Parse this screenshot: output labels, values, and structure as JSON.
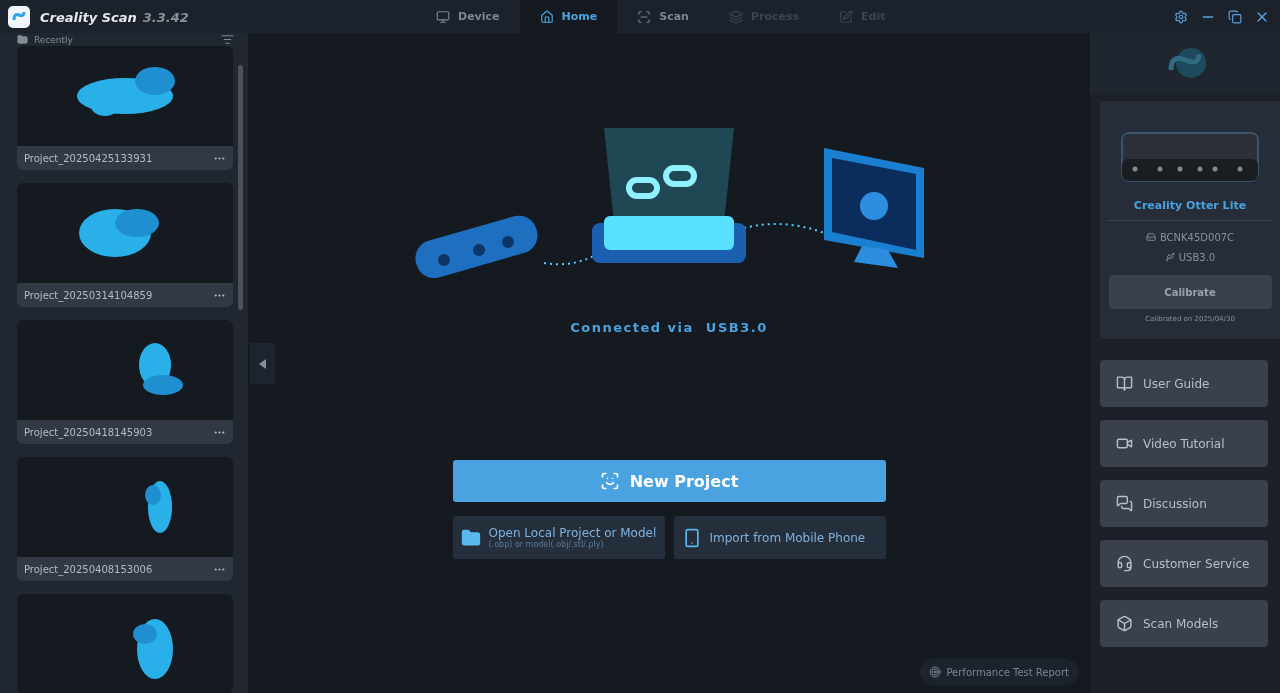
{
  "app": {
    "name": "Creality Scan",
    "version": "3.3.42"
  },
  "tabs": [
    {
      "label": "Device",
      "selected": false,
      "disabled": false
    },
    {
      "label": "Home",
      "selected": true,
      "disabled": false
    },
    {
      "label": "Scan",
      "selected": false,
      "disabled": false
    },
    {
      "label": "Process",
      "selected": false,
      "disabled": true
    },
    {
      "label": "Edit",
      "selected": false,
      "disabled": true
    }
  ],
  "sidebar": {
    "title": "Recently",
    "projects": [
      {
        "name": "Project_20250425133931"
      },
      {
        "name": "Project_20250314104859"
      },
      {
        "name": "Project_20250418145903"
      },
      {
        "name": "Project_20250408153006"
      }
    ],
    "more_below": true
  },
  "connection": {
    "status": "Connected via  USB3.0"
  },
  "actions": {
    "primary": "New Project",
    "secondary": [
      {
        "label": "Open Local Project or Model",
        "hint": "(.obp) or model(.obj/.stl/.ply)"
      },
      {
        "label": "Import from Mobile Phone"
      }
    ]
  },
  "performance_link": "Performance Test Report",
  "device": {
    "name": "Creality Otter Lite",
    "serial": "BCNK45D007C",
    "port": "USB3.0",
    "calibrate": "Calibrate",
    "calibrated": "Calibrated on 2025/04/30"
  },
  "links": [
    {
      "label": "User Guide"
    },
    {
      "label": "Video Tutorial"
    },
    {
      "label": "Discussion"
    },
    {
      "label": "Customer Service"
    },
    {
      "label": "Scan Models"
    }
  ]
}
